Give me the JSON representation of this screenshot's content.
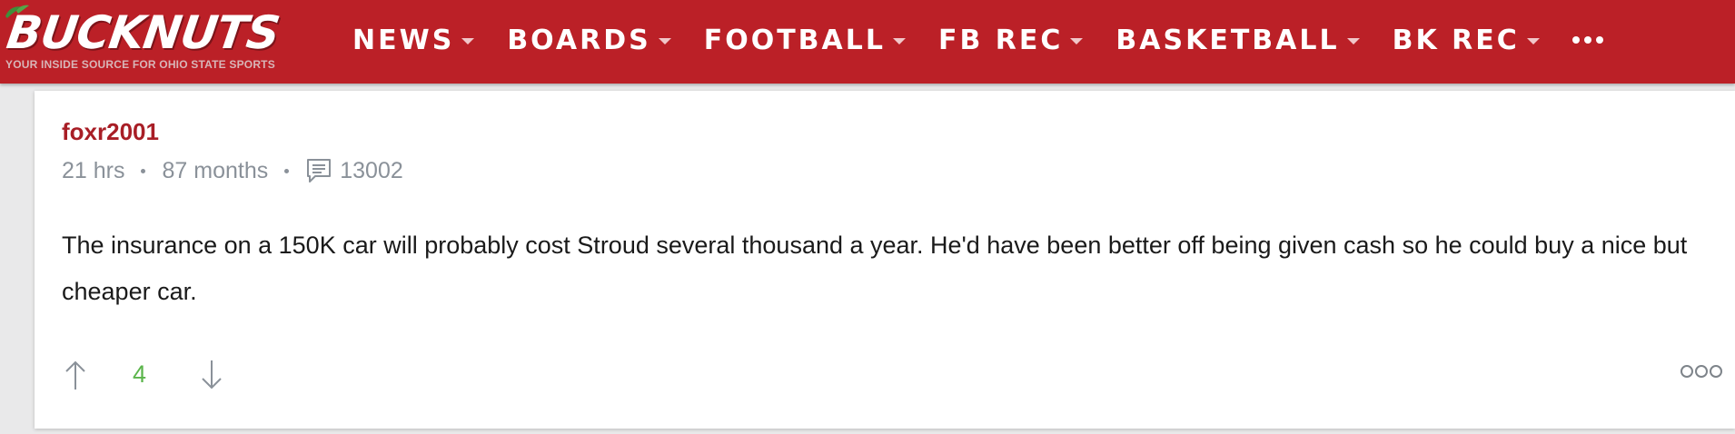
{
  "site": {
    "logo_text": "BUCKNUTS",
    "tagline": "YOUR INSIDE SOURCE FOR OHIO STATE SPORTS",
    "brand_color": "#bb2027"
  },
  "nav": {
    "items": [
      {
        "label": "NEWS"
      },
      {
        "label": "BOARDS"
      },
      {
        "label": "FOOTBALL"
      },
      {
        "label": "FB REC"
      },
      {
        "label": "BASKETBALL"
      },
      {
        "label": "BK REC"
      }
    ],
    "more_icon": "more-dots-icon"
  },
  "post": {
    "username": "foxr2001",
    "time_ago": "21 hrs",
    "member_for": "87 months",
    "comment_count": "13002",
    "body": "The insurance on a 150K car will probably cost Stroud several thousand a year. He'd have been better off being given cash so he could buy a nice but cheaper car.",
    "vote_count": "4",
    "username_color": "#a81e26",
    "vote_count_color": "#5bb54b"
  }
}
